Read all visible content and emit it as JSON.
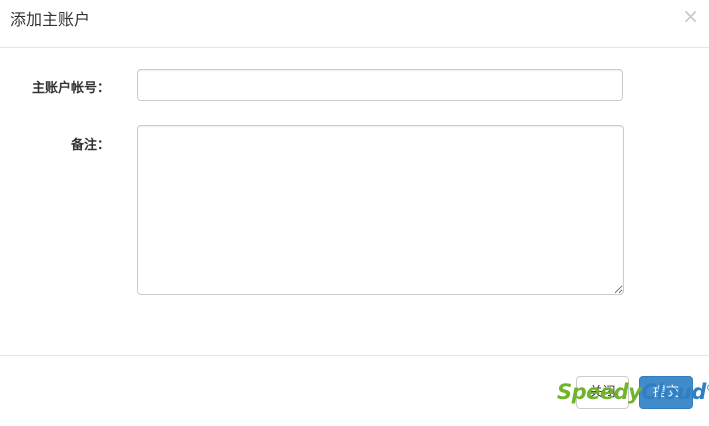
{
  "modal": {
    "title": "添加主账户",
    "close_symbol": "×"
  },
  "form": {
    "account_label": "主账户帐号：",
    "account_value": "",
    "remark_label": "备注：",
    "remark_value": ""
  },
  "footer": {
    "close_label": "关闭",
    "submit_label": "提交"
  },
  "watermark": {
    "text_part1": "Speedy",
    "text_part2": "Cloud",
    "mark": "®"
  },
  "colors": {
    "primary": "#428bca",
    "border": "#cccccc",
    "watermark_green": "#6fb52b",
    "watermark_blue": "#2f7fc3"
  }
}
